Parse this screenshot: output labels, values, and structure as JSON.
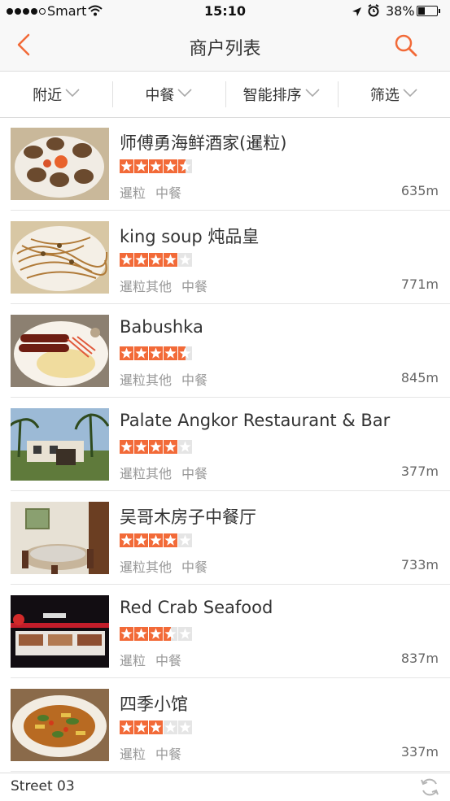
{
  "status": {
    "carrier": "Smart",
    "time": "15:10",
    "battery": "38%",
    "battery_level": 0.38,
    "signal_bars": 4,
    "signal_total": 5
  },
  "header": {
    "title": "商户列表"
  },
  "filters": [
    "附近",
    "中餐",
    "智能排序",
    "筛选"
  ],
  "accent_color": "#f26a38",
  "restaurants": [
    {
      "name": "师傅勇海鲜酒家(暹粒)",
      "rating": 4.5,
      "tags": [
        "暹粒",
        "中餐"
      ],
      "distance": "635m"
    },
    {
      "name": "king soup 炖品皇",
      "rating": 4,
      "tags": [
        "暹粒其他",
        "中餐"
      ],
      "distance": "771m"
    },
    {
      "name": "Babushka",
      "rating": 4.5,
      "tags": [
        "暹粒其他",
        "中餐"
      ],
      "distance": "845m"
    },
    {
      "name": "Palate Angkor Restaurant & Bar",
      "rating": 4,
      "tags": [
        "暹粒其他",
        "中餐"
      ],
      "distance": "377m"
    },
    {
      "name": "吴哥木房子中餐厅",
      "rating": 4,
      "tags": [
        "暹粒其他",
        "中餐"
      ],
      "distance": "733m"
    },
    {
      "name": "Red Crab Seafood",
      "rating": 3.5,
      "tags": [
        "暹粒",
        "中餐"
      ],
      "distance": "837m"
    },
    {
      "name": "四季小馆",
      "rating": 3,
      "tags": [
        "暹粒",
        "中餐"
      ],
      "distance": "337m"
    }
  ],
  "footer": {
    "location": "Street 03"
  }
}
